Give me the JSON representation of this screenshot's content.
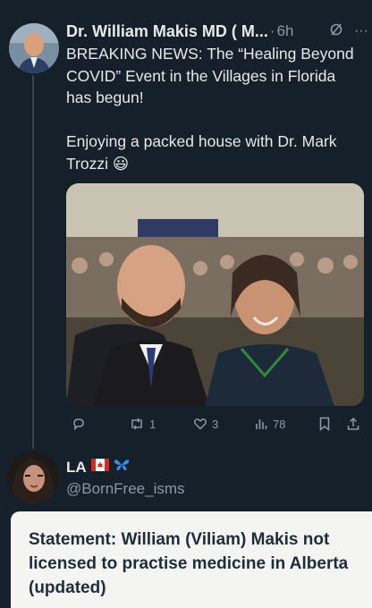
{
  "tweet": {
    "author_name": "Dr. William Makis MD ( M...",
    "separator": "·",
    "time": "6h",
    "more_label": "···",
    "text": "BREAKING NEWS: The “Healing Beyond COVID” Event in the Villages in Florida has begun!\n\nEnjoying a packed house with Dr. Mark Trozzi 😃",
    "stats": {
      "replies": "",
      "retweets": "1",
      "likes": "3",
      "views": "78"
    }
  },
  "reply": {
    "name": "LA",
    "flag_emoji": "🇨🇦",
    "butterfly_emoji": "🦋",
    "handle": "@BornFree_isms"
  },
  "card": {
    "title": "Statement: William (Viliam) Makis not licensed to practise medicine in Alberta (updated)"
  },
  "colors": {
    "background": "#15202b",
    "text": "#e7e9ea",
    "muted": "#8b98a5",
    "card_bg": "#f4f4f3",
    "card_text": "#1f2d3a"
  },
  "icons": {
    "reply": "reply-icon",
    "retweet": "retweet-icon",
    "like": "heart-icon",
    "views": "views-icon",
    "bookmark": "bookmark-icon",
    "share": "share-icon",
    "grok": "grok-icon"
  }
}
